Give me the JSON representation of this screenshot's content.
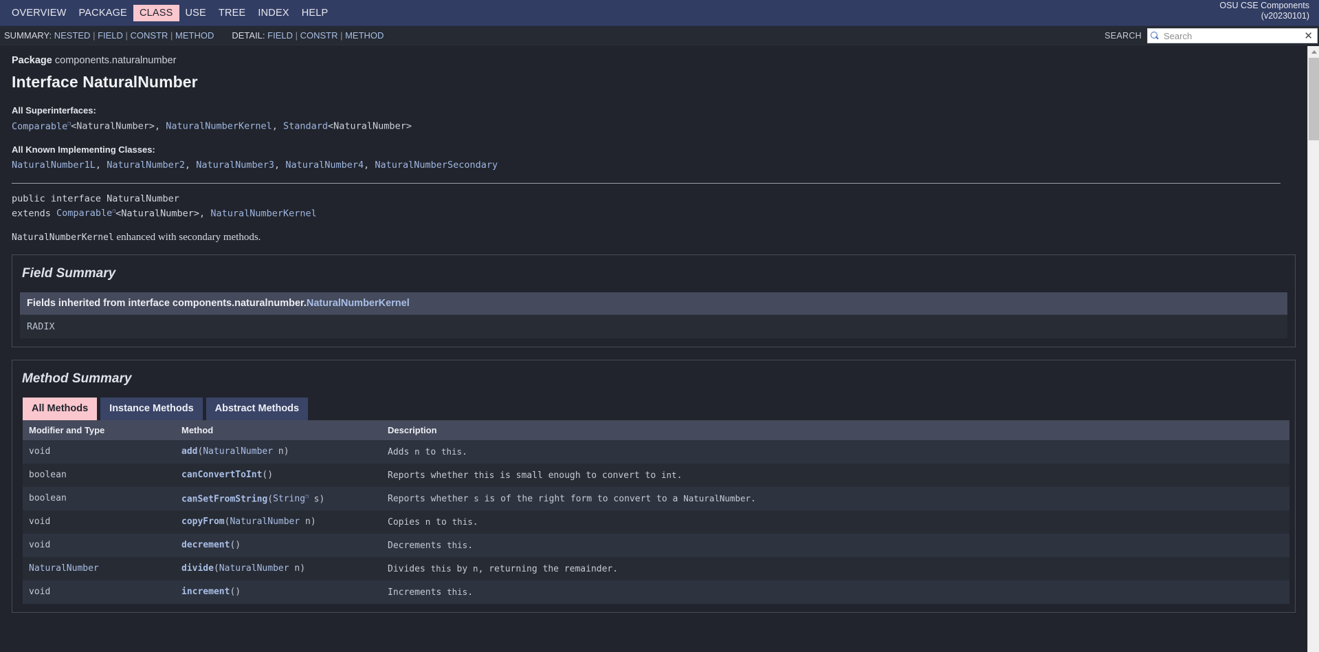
{
  "topnav": {
    "items": [
      {
        "label": "OVERVIEW",
        "active": false
      },
      {
        "label": "PACKAGE",
        "active": false
      },
      {
        "label": "CLASS",
        "active": true
      },
      {
        "label": "USE",
        "active": false
      },
      {
        "label": "TREE",
        "active": false
      },
      {
        "label": "INDEX",
        "active": false
      },
      {
        "label": "HELP",
        "active": false
      }
    ],
    "about_line1": "OSU CSE Components",
    "about_line2": "(v20230101)"
  },
  "subnav": {
    "summary_label": "SUMMARY:",
    "summary_items": [
      "NESTED",
      "FIELD",
      "CONSTR",
      "METHOD"
    ],
    "detail_label": "DETAIL:",
    "detail_items": [
      "FIELD",
      "CONSTR",
      "METHOD"
    ],
    "search_label": "SEARCH",
    "search_placeholder": "Search",
    "search_value": "",
    "reset_glyph": "✕"
  },
  "header": {
    "package_label": "Package",
    "package_name": "components.naturalnumber",
    "title": "Interface NaturalNumber",
    "superinterfaces_label": "All Superinterfaces:",
    "superinterfaces": [
      {
        "text": "Comparable",
        "link": true,
        "external": true
      },
      {
        "text": "<NaturalNumber>",
        "link": false,
        "external": false
      },
      {
        "text": ", ",
        "link": false,
        "external": false
      },
      {
        "text": "NaturalNumberKernel",
        "link": true,
        "external": false
      },
      {
        "text": ", ",
        "link": false,
        "external": false
      },
      {
        "text": "Standard",
        "link": true,
        "external": false
      },
      {
        "text": "<NaturalNumber>",
        "link": false,
        "external": false
      }
    ],
    "implementing_label": "All Known Implementing Classes:",
    "implementing_classes": [
      "NaturalNumber1L",
      "NaturalNumber2",
      "NaturalNumber3",
      "NaturalNumber4",
      "NaturalNumberSecondary"
    ],
    "decl_line1": "public interface NaturalNumber",
    "decl_extends_kw": "extends ",
    "decl_comparable": "Comparable",
    "decl_generic": "<NaturalNumber>, ",
    "decl_kernel": "NaturalNumberKernel",
    "description_code": "NaturalNumberKernel",
    "description_rest": " enhanced with secondary methods."
  },
  "field_summary": {
    "title": "Field Summary",
    "inherited_prefix": "Fields inherited from interface components.naturalnumber.",
    "inherited_link": "NaturalNumberKernel",
    "fields": [
      "RADIX"
    ]
  },
  "method_summary": {
    "title": "Method Summary",
    "tabs": [
      {
        "label": "All Methods",
        "active": true
      },
      {
        "label": "Instance Methods",
        "active": false
      },
      {
        "label": "Abstract Methods",
        "active": false
      }
    ],
    "columns": [
      "Modifier and Type",
      "Method",
      "Description"
    ],
    "rows": [
      {
        "modifier": "void",
        "modifier_link": false,
        "method_name": "add",
        "method_open": "(",
        "method_param_type": "NaturalNumber",
        "method_param_type_link": true,
        "method_param_type_external": false,
        "method_param_name": " n",
        "method_close": ")",
        "desc_pre": "Adds ",
        "desc_code1": "n",
        "desc_mid": " to ",
        "desc_code2": "this",
        "desc_post": "."
      },
      {
        "modifier": "boolean",
        "modifier_link": false,
        "method_name": "canConvertToInt",
        "method_open": "(",
        "method_param_type": "",
        "method_param_type_link": false,
        "method_param_type_external": false,
        "method_param_name": "",
        "method_close": ")",
        "desc_pre": "Reports whether ",
        "desc_code1": "this",
        "desc_mid": " is small enough to convert to ",
        "desc_code2": "int",
        "desc_post": "."
      },
      {
        "modifier": "boolean",
        "modifier_link": false,
        "method_name": "canSetFromString",
        "method_open": "(",
        "method_param_type": "String",
        "method_param_type_link": true,
        "method_param_type_external": true,
        "method_param_name": " s",
        "method_close": ")",
        "desc_pre": "Reports whether ",
        "desc_code1": "s",
        "desc_mid": " is of the right form to convert to a ",
        "desc_code2": "NaturalNumber",
        "desc_post": "."
      },
      {
        "modifier": "void",
        "modifier_link": false,
        "method_name": "copyFrom",
        "method_open": "(",
        "method_param_type": "NaturalNumber",
        "method_param_type_link": true,
        "method_param_type_external": false,
        "method_param_name": " n",
        "method_close": ")",
        "desc_pre": "Copies ",
        "desc_code1": "n",
        "desc_mid": " to ",
        "desc_code2": "this",
        "desc_post": "."
      },
      {
        "modifier": "void",
        "modifier_link": false,
        "method_name": "decrement",
        "method_open": "(",
        "method_param_type": "",
        "method_param_type_link": false,
        "method_param_type_external": false,
        "method_param_name": "",
        "method_close": ")",
        "desc_pre": "Decrements ",
        "desc_code1": "",
        "desc_mid": "",
        "desc_code2": "this",
        "desc_post": "."
      },
      {
        "modifier": "NaturalNumber",
        "modifier_link": true,
        "method_name": "divide",
        "method_open": "(",
        "method_param_type": "NaturalNumber",
        "method_param_type_link": true,
        "method_param_type_external": false,
        "method_param_name": " n",
        "method_close": ")",
        "desc_pre": "Divides ",
        "desc_code1": "this",
        "desc_mid": " by ",
        "desc_code2": "n",
        "desc_post": ", returning the remainder."
      },
      {
        "modifier": "void",
        "modifier_link": false,
        "method_name": "increment",
        "method_open": "(",
        "method_param_type": "",
        "method_param_type_link": false,
        "method_param_type_external": false,
        "method_param_name": "",
        "method_close": ")",
        "desc_pre": "Increments ",
        "desc_code1": "",
        "desc_mid": "",
        "desc_code2": "this",
        "desc_post": "."
      }
    ]
  },
  "colors": {
    "nav_bg": "#323d64",
    "accent_pink": "#fbc7cf",
    "page_bg": "#21242c",
    "table_header_bg": "#454a5c",
    "link": "#a9bfe6"
  }
}
